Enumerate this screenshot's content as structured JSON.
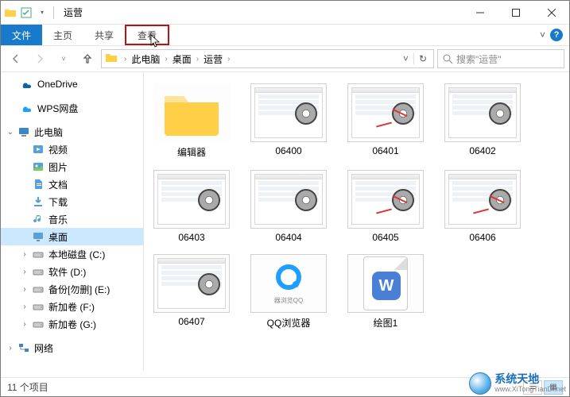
{
  "title": "运营",
  "tabs": {
    "file": "文件",
    "home": "主页",
    "share": "共享",
    "view": "查看"
  },
  "breadcrumb": {
    "items": [
      "此电脑",
      "桌面",
      "运营"
    ]
  },
  "search": {
    "placeholder": "搜索\"运营\""
  },
  "sidebar": {
    "onedrive": "OneDrive",
    "wps": "WPS网盘",
    "thispc": "此电脑",
    "children": [
      {
        "label": "视频",
        "icon": "video"
      },
      {
        "label": "图片",
        "icon": "pictures"
      },
      {
        "label": "文档",
        "icon": "documents"
      },
      {
        "label": "下载",
        "icon": "downloads"
      },
      {
        "label": "音乐",
        "icon": "music"
      },
      {
        "label": "桌面",
        "icon": "desktop",
        "selected": true
      },
      {
        "label": "本地磁盘 (C:)",
        "icon": "drive"
      },
      {
        "label": "软件 (D:)",
        "icon": "drive"
      },
      {
        "label": "备份[勿删] (E:)",
        "icon": "drive"
      },
      {
        "label": "新加卷 (F:)",
        "icon": "drive"
      },
      {
        "label": "新加卷 (G:)",
        "icon": "drive"
      }
    ],
    "network": "网络"
  },
  "items": [
    {
      "name": "编辑器",
      "type": "folder"
    },
    {
      "name": "06400",
      "type": "video"
    },
    {
      "name": "06401",
      "type": "video",
      "red": true
    },
    {
      "name": "06402",
      "type": "video"
    },
    {
      "name": "06403",
      "type": "video"
    },
    {
      "name": "06404",
      "type": "video"
    },
    {
      "name": "06405",
      "type": "video",
      "red": true
    },
    {
      "name": "06406",
      "type": "video",
      "red": true
    },
    {
      "name": "06407",
      "type": "video"
    },
    {
      "name": "QQ浏览器",
      "type": "qq"
    },
    {
      "name": "绘图1",
      "type": "wps"
    }
  ],
  "status": {
    "count": "11 个项目"
  },
  "watermark": {
    "cn": "系统天地",
    "en": "www.XiTongTianDi.net"
  }
}
